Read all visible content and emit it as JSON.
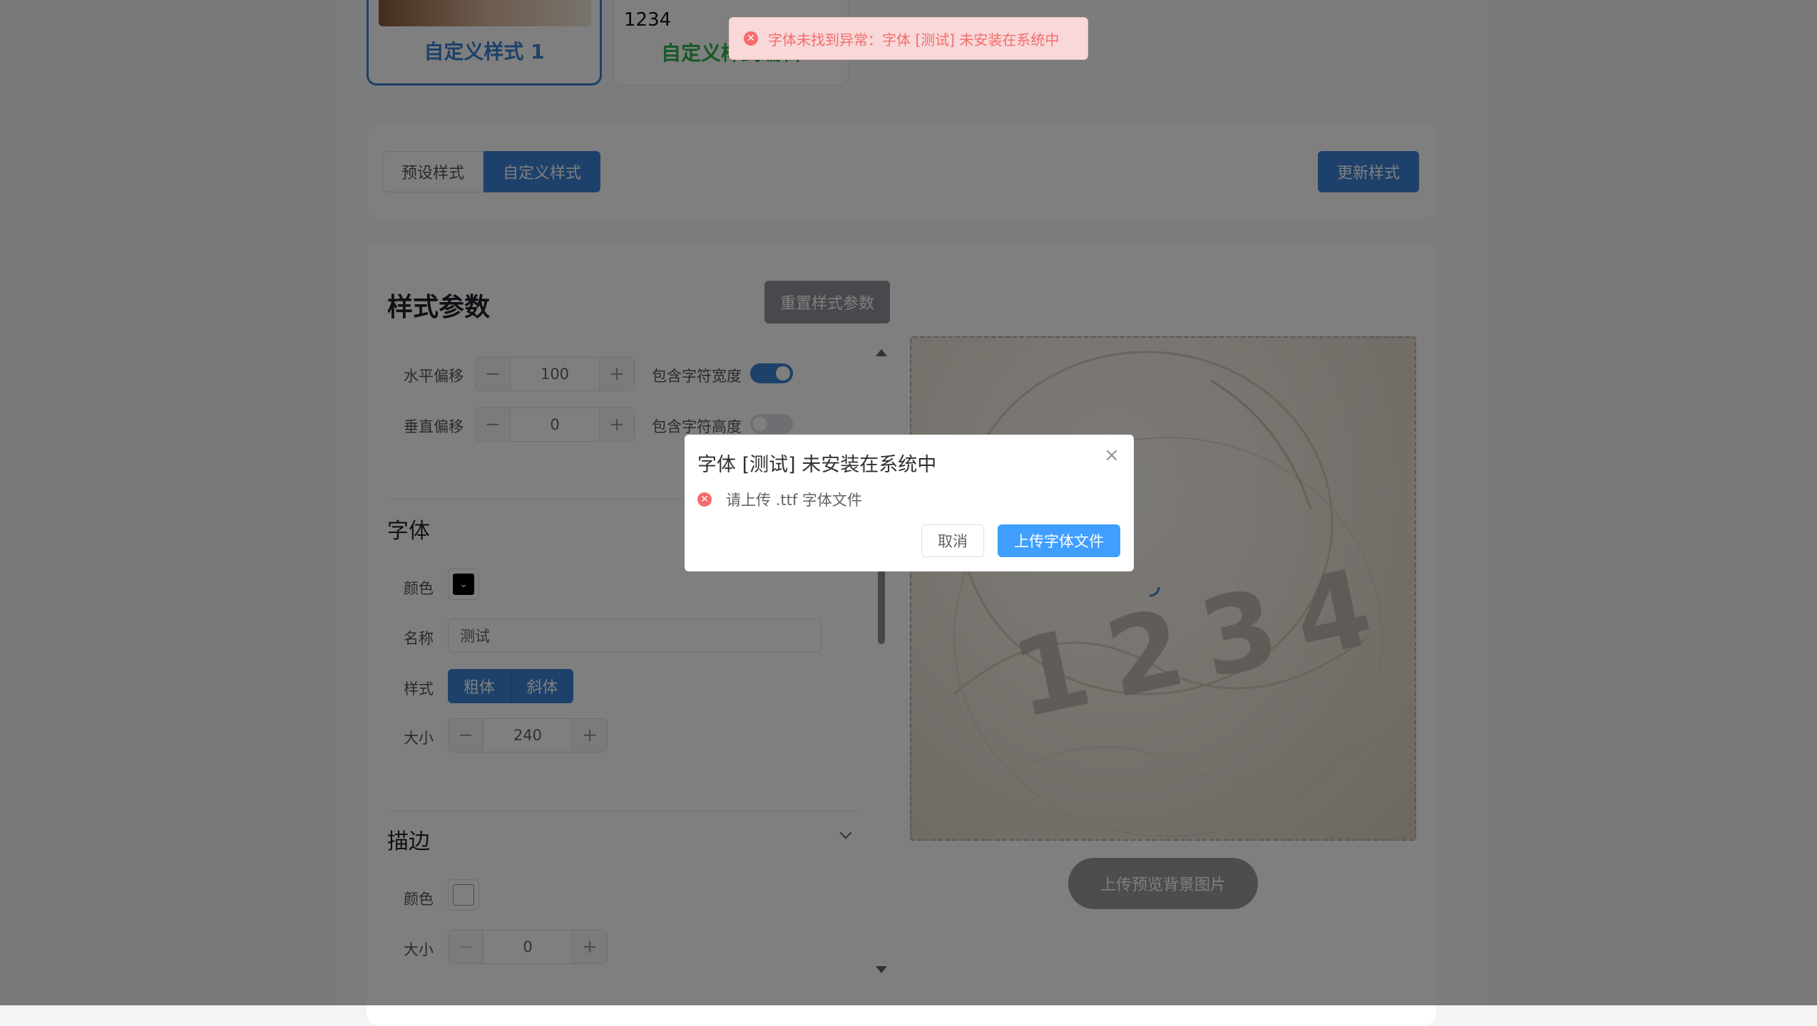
{
  "cards": {
    "card1_label": "自定义样式 1",
    "card2_label": "自定义样式编辑",
    "card2_preview_text": "1234"
  },
  "toolbar": {
    "tab_preset": "预设样式",
    "tab_custom": "自定义样式",
    "update_button": "更新样式"
  },
  "params": {
    "title": "样式参数",
    "reset_button": "重置样式参数",
    "h_offset_label": "水平偏移",
    "h_offset_value": "100",
    "v_offset_label": "垂直偏移",
    "v_offset_value": "0",
    "include_width_label": "包含字符宽度",
    "include_width_on": true,
    "include_height_label": "包含字符高度",
    "include_height_on": false
  },
  "font": {
    "title": "字体",
    "color_label": "颜色",
    "color_value": "#000000",
    "name_label": "名称",
    "name_value": "测试",
    "style_label": "样式",
    "bold_label": "粗体",
    "italic_label": "斜体",
    "size_label": "大小",
    "size_value": "240"
  },
  "stroke": {
    "title": "描边",
    "color_label": "颜色",
    "color_value": "#ffffff",
    "size_label": "大小",
    "size_value": "0"
  },
  "preview": {
    "digits": "1234",
    "upload_bg_button": "上传预览背景图片"
  },
  "toast": {
    "message": "字体未找到异常：字体 [测试] 未安装在系统中"
  },
  "dialog": {
    "title": "字体 [测试] 未安装在系统中",
    "message": "请上传 .ttf 字体文件",
    "cancel_button": "取消",
    "upload_button": "上传字体文件"
  },
  "colors": {
    "accent": "#3b82d4",
    "green": "#2bb24c",
    "error": "#f56c6c",
    "dialog_primary": "#409eff"
  }
}
